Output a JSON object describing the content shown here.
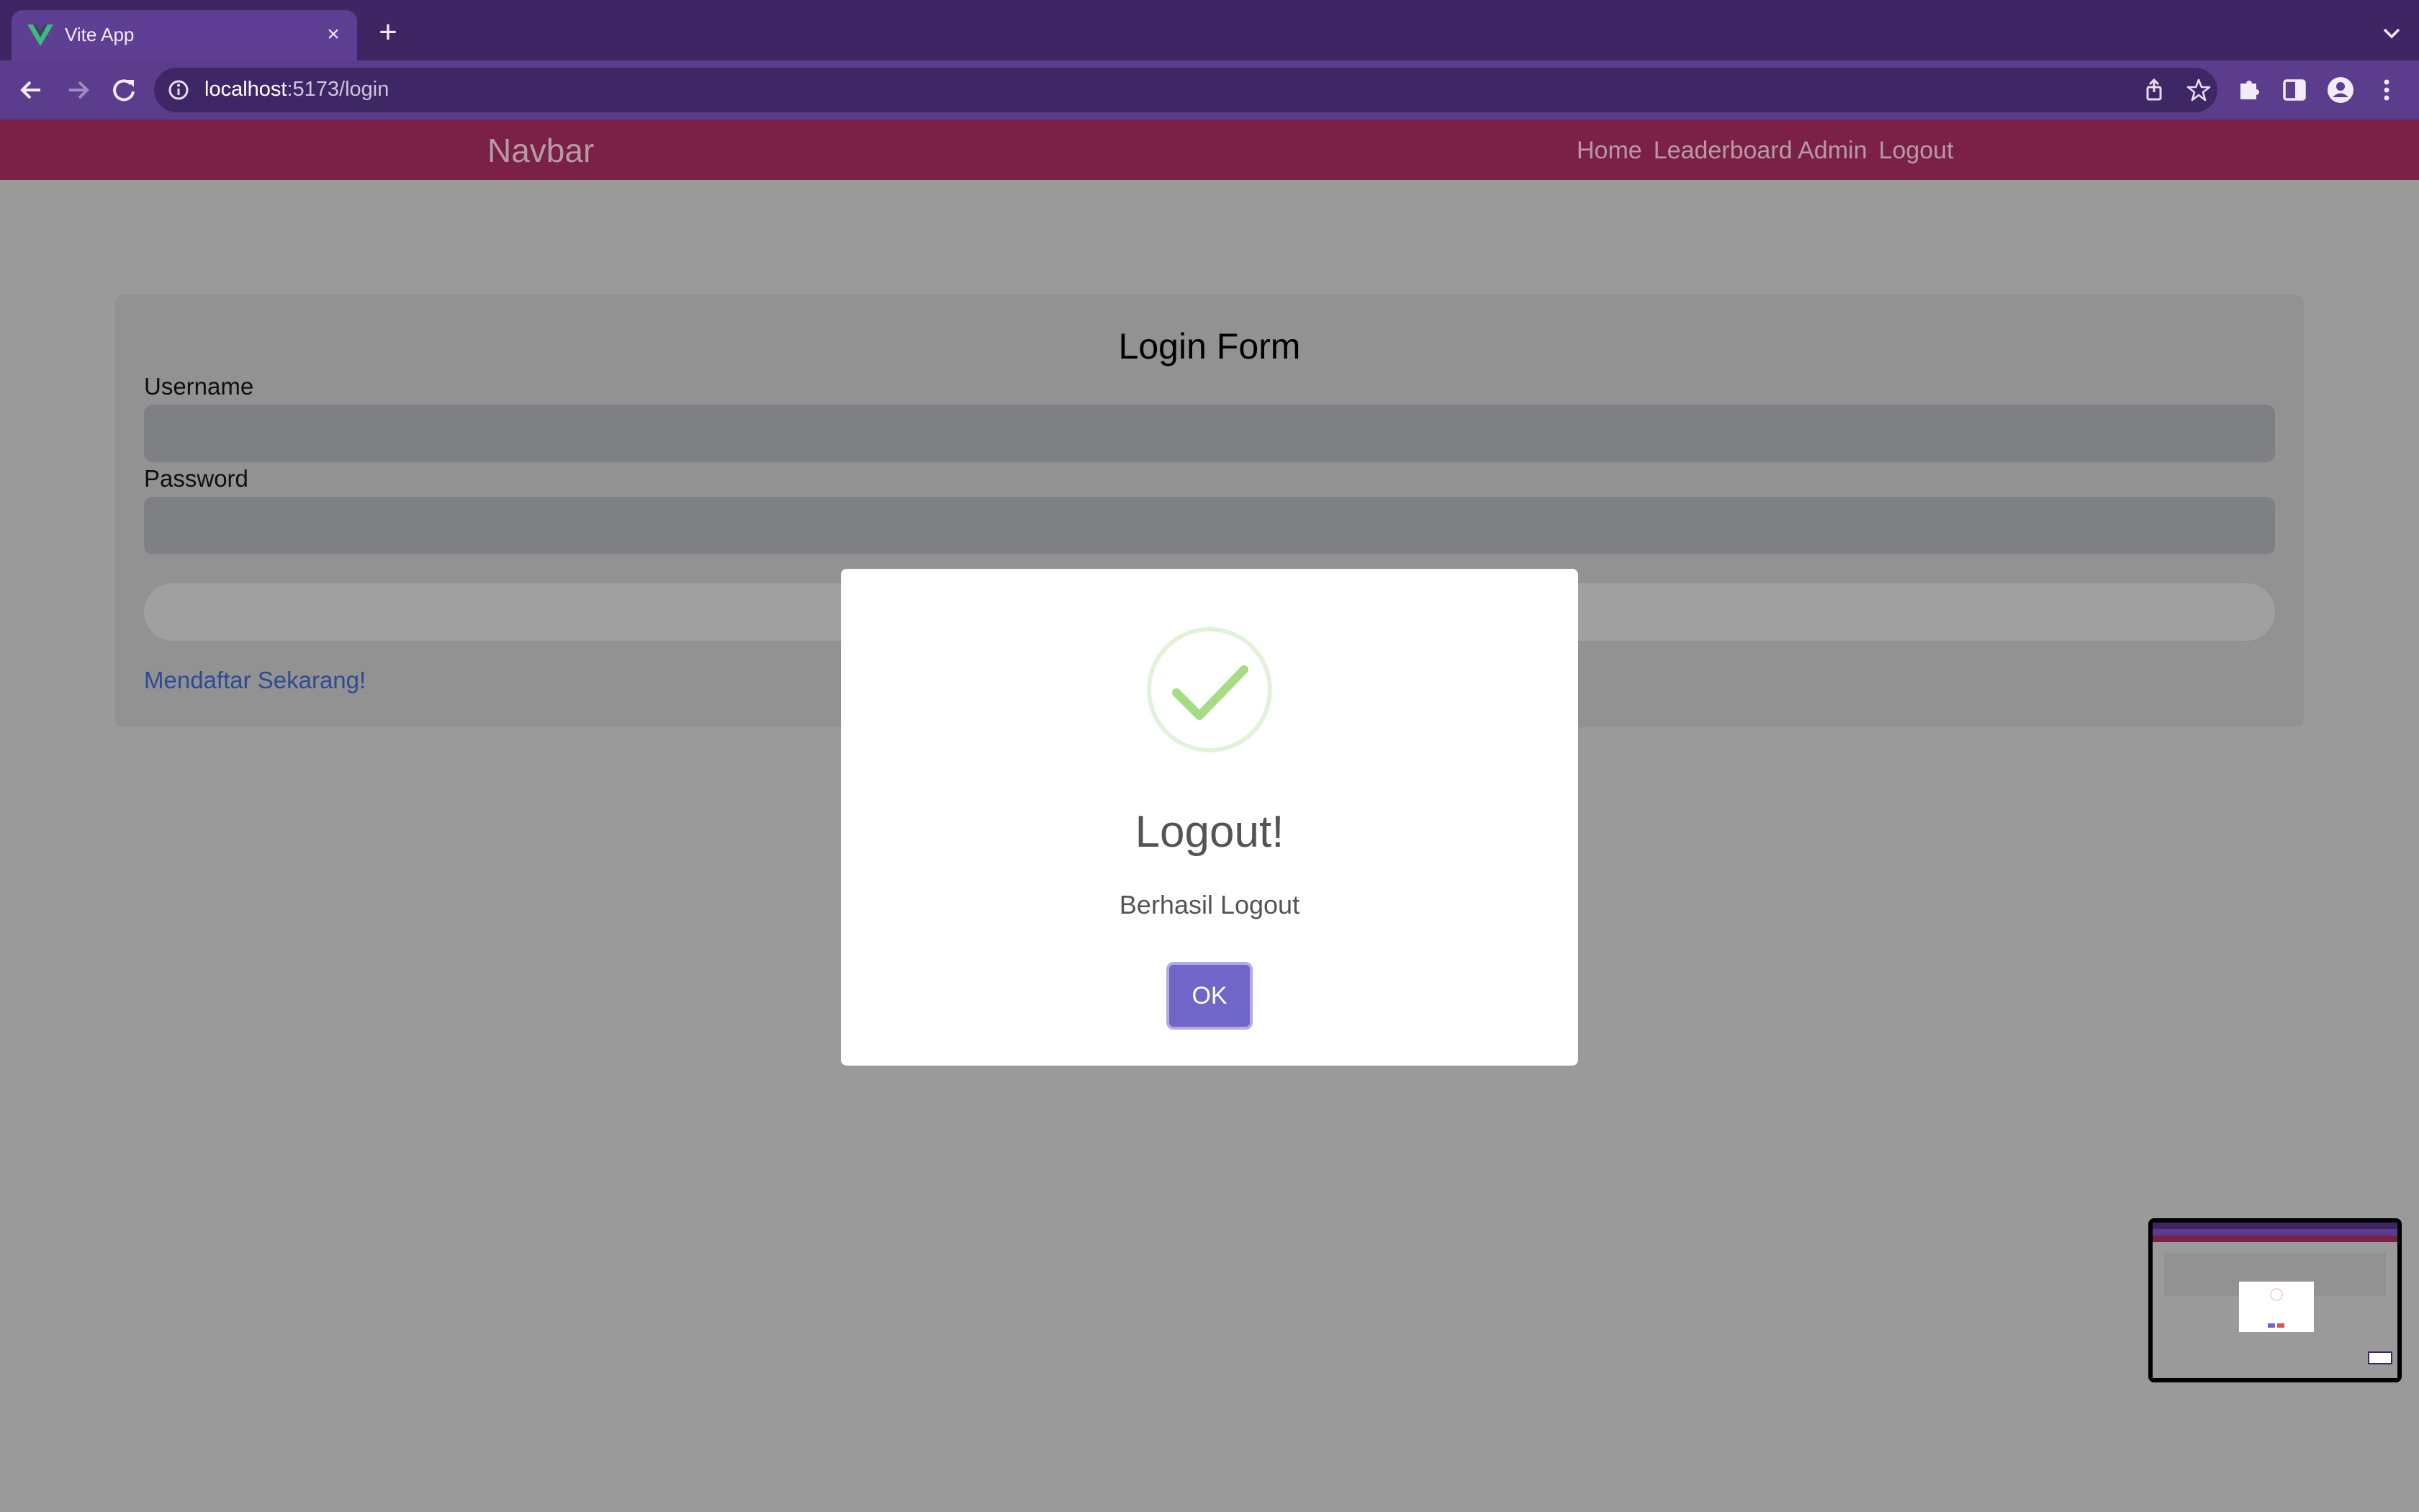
{
  "browser": {
    "tab_title": "Vite App",
    "url_host": "localhost",
    "url_rest": ":5173/login"
  },
  "navbar": {
    "brand": "Navbar",
    "links": [
      "Home",
      "Leaderboard Admin",
      "Logout"
    ]
  },
  "form": {
    "title": "Login Form",
    "username_label": "Username",
    "username_value": "",
    "password_label": "Password",
    "password_value": "",
    "submit_label": "",
    "register_link": "Mendaftar Sekarang!"
  },
  "modal": {
    "icon": "success-check-icon",
    "title": "Logout!",
    "text": "Berhasil Logout",
    "ok_label": "OK"
  },
  "colors": {
    "tabstrip": "#3f2564",
    "toolbar": "#5c3c8c",
    "navbar": "#7b2046",
    "ok_button": "#7066c7",
    "success_check": "#a5dc86",
    "link": "#2d4b94"
  }
}
